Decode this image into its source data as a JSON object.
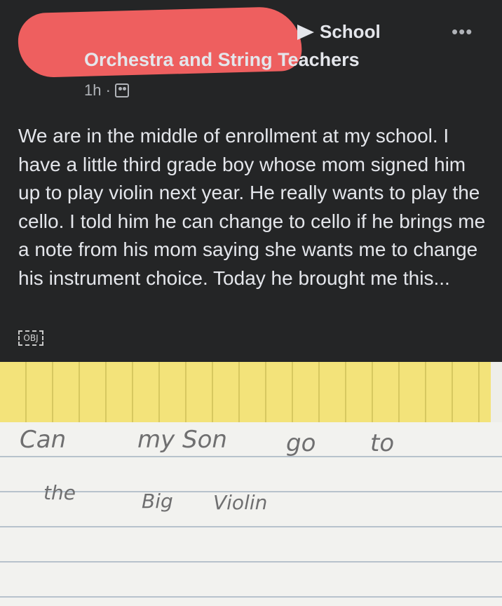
{
  "header": {
    "group_line1": "School",
    "group_line2": "Orchestra and String Teachers",
    "time": "1h ·",
    "audience_icon": "group-icon",
    "more": "•••"
  },
  "post": {
    "text": "We are in the middle of enrollment at my school. I have a little third grade boy whose mom signed him up to play violin next year. He really wants to play the cello. I told him he can change to cello if he brings me a note from his mom saying she wants me to change his instrument choice. Today he brought me this...",
    "obj_label": "OBJ"
  },
  "note": {
    "line1": [
      "Can",
      "my Son",
      "go",
      "to"
    ],
    "line2": [
      "the",
      "Big",
      "Violin"
    ]
  },
  "colors": {
    "background": "#242526",
    "text": "#e4e6eb",
    "redaction": "#ee5f5f"
  }
}
